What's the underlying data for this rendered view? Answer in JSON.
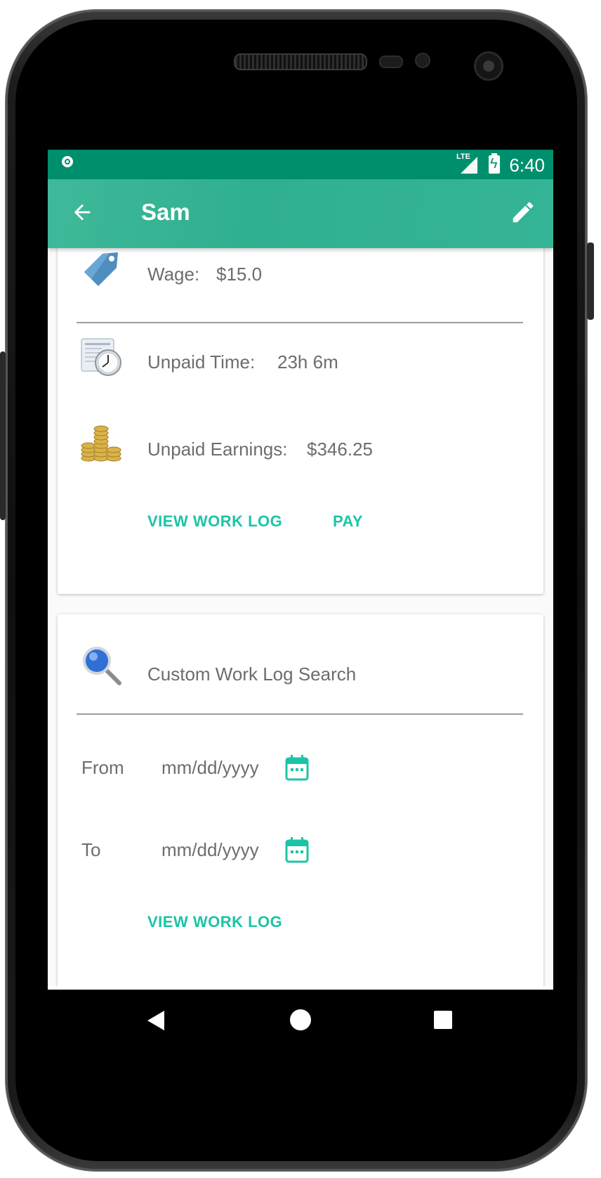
{
  "status": {
    "network": "LTE",
    "time": "6:40"
  },
  "appbar": {
    "title": "Sam",
    "back_icon": "arrow-back-icon",
    "edit_icon": "pencil-icon"
  },
  "summary_card": {
    "wage": {
      "label": "Wage:",
      "value": "$15.0",
      "icon": "price-tag-icon"
    },
    "unpaid_time": {
      "label": "Unpaid Time:",
      "value": "23h 6m",
      "icon": "clock-document-icon"
    },
    "unpaid_earnings": {
      "label": "Unpaid Earnings:",
      "value": "$346.25",
      "icon": "gold-coins-icon"
    },
    "view_work_log_label": "VIEW WORK LOG",
    "pay_label": "PAY"
  },
  "search_card": {
    "title": "Custom Work Log Search",
    "icon": "magnifier-icon",
    "from": {
      "label": "From",
      "placeholder": "mm/dd/yyyy"
    },
    "to": {
      "label": "To",
      "placeholder": "mm/dd/yyyy"
    },
    "view_work_log_label": "VIEW WORK LOG"
  },
  "colors": {
    "status_bar": "#008f6c",
    "app_bar": "#33b393",
    "accent": "#1cc4a6",
    "text": "#6d6d6d"
  }
}
